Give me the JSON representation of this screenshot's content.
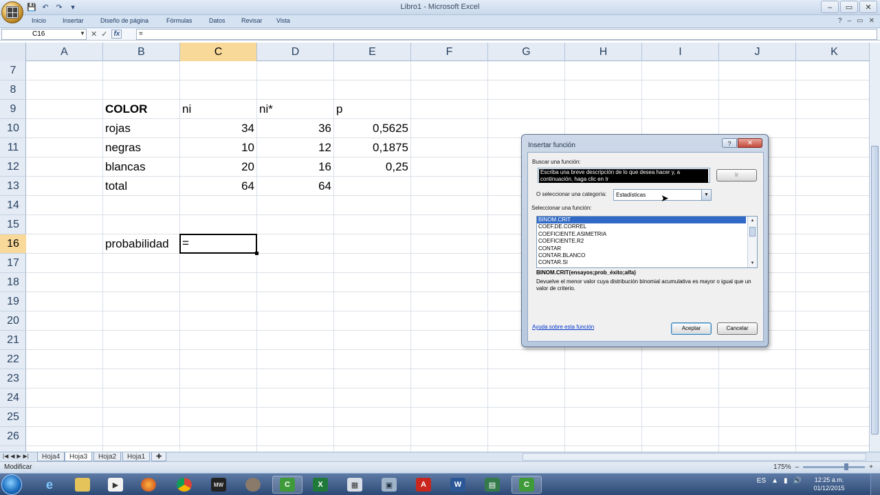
{
  "window": {
    "title": "Libro1 - Microsoft Excel"
  },
  "ribbon": {
    "tabs": [
      "Inicio",
      "Insertar",
      "Diseño de página",
      "Fórmulas",
      "Datos",
      "Revisar",
      "Vista"
    ]
  },
  "formula_bar": {
    "name_box": "C16",
    "formula": "="
  },
  "columns": [
    "A",
    "B",
    "C",
    "D",
    "E",
    "F",
    "G",
    "H",
    "I",
    "J",
    "K"
  ],
  "rows": [
    "7",
    "8",
    "9",
    "10",
    "11",
    "12",
    "13",
    "14",
    "15",
    "16",
    "17",
    "18",
    "19",
    "20",
    "21",
    "22",
    "23",
    "24",
    "25",
    "26"
  ],
  "cells": {
    "header": [
      "COLOR",
      "ni",
      "ni*",
      "p"
    ],
    "data": [
      [
        "rojas",
        "34",
        "36",
        "0,5625"
      ],
      [
        "negras",
        "10",
        "12",
        "0,1875"
      ],
      [
        "blancas",
        "20",
        "16",
        "0,25"
      ],
      [
        "total",
        "64",
        "64",
        ""
      ]
    ],
    "prob_label": "probabilidad",
    "prob_formula": "="
  },
  "sheets": [
    "Hoja4",
    "Hoja3",
    "Hoja2",
    "Hoja1"
  ],
  "active_sheet": "Hoja3",
  "status": {
    "mode": "Modificar",
    "zoom": "175%"
  },
  "dialog": {
    "title": "Insertar función",
    "search_label": "Buscar una función:",
    "search_placeholder": "Escriba una breve descripción de lo que desea hacer y, a continuación, haga clic en Ir",
    "ir_label": "Ir",
    "category_label": "O seleccionar una categoría:",
    "category_value": "Estadísticas",
    "select_label": "Seleccionar una función:",
    "functions": [
      "BINOM.CRIT",
      "COEF.DE.CORREL",
      "COEFICIENTE.ASIMETRIA",
      "COEFICIENTE.R2",
      "CONTAR",
      "CONTAR.BLANCO",
      "CONTAR.SI"
    ],
    "syntax": "BINOM.CRIT(ensayos;prob_éxito;alfa)",
    "description": "Devuelve el menor valor cuya distribución binomial acumulativa es mayor o igual que un valor de criterio.",
    "help_link": "Ayuda sobre esta función",
    "accept": "Aceptar",
    "cancel": "Cancelar"
  },
  "taskbar": {
    "clock_time": "12:25 a.m.",
    "clock_date": "01/12/2015",
    "language": "ES"
  }
}
